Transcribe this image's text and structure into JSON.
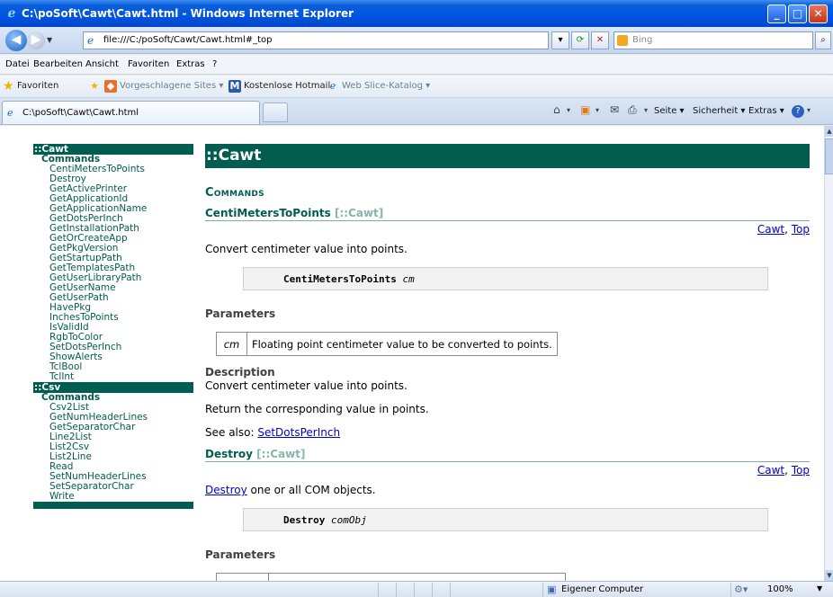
{
  "window": {
    "title": "C:\\poSoft\\Cawt\\Cawt.html - Windows Internet Explorer",
    "min_icon": "minimize-icon",
    "max_icon": "maximize-icon",
    "close_icon": "close-icon"
  },
  "address": {
    "url": "file:///C:/poSoft/Cawt/Cawt.html#_top",
    "search_placeholder": "Bing"
  },
  "menu": [
    "Datei",
    "Bearbeiten",
    "Ansicht",
    "Favoriten",
    "Extras",
    "?"
  ],
  "favorites": {
    "label": "Favoriten",
    "items": [
      "Vorgeschlagene Sites ▾",
      "Kostenlose Hotmail",
      "Web Slice-Katalog ▾"
    ]
  },
  "tab": {
    "label": "C:\\poSoft\\Cawt\\Cawt.html"
  },
  "commands": {
    "page": "Seite ▾",
    "security": "Sicherheit ▾",
    "extras": "Extras ▾"
  },
  "sidebar": {
    "sections": [
      {
        "ns": "::Cawt",
        "commands_label": "Commands",
        "items": [
          "CentiMetersToPoints",
          "Destroy",
          "GetActivePrinter",
          "GetApplicationId",
          "GetApplicationName",
          "GetDotsPerInch",
          "GetInstallationPath",
          "GetOrCreateApp",
          "GetPkgVersion",
          "GetStartupPath",
          "GetTemplatesPath",
          "GetUserLibraryPath",
          "GetUserName",
          "GetUserPath",
          "HavePkg",
          "InchesToPoints",
          "IsValidId",
          "RgbToColor",
          "SetDotsPerInch",
          "ShowAlerts",
          "TclBool",
          "TclInt"
        ]
      },
      {
        "ns": "::Csv",
        "commands_label": "Commands",
        "items": [
          "Csv2List",
          "GetNumHeaderLines",
          "GetSeparatorChar",
          "Line2List",
          "List2Csv",
          "List2Line",
          "Read",
          "SetNumHeaderLines",
          "SetSeparatorChar",
          "Write"
        ]
      }
    ]
  },
  "main": {
    "heading": "::Cawt",
    "commands_heading": "Commands",
    "procs": [
      {
        "name": "CentiMetersToPoints",
        "ns": "[::Cawt]",
        "link_cawt": "Cawt",
        "link_sep": ", ",
        "link_top": "Top",
        "summary": "Convert centimeter value into points.",
        "code_proc": "CentiMetersToPoints",
        "code_arg": "cm",
        "params_heading": "Parameters",
        "param_name": "cm",
        "param_desc": "Floating point centimeter value to be converted to points.",
        "desc_heading": "Description",
        "desc_line1": "Convert centimeter value into points.",
        "desc_line2": "Return the corresponding value in points.",
        "see_also_label": "See also: ",
        "see_also_link": "SetDotsPerInch"
      },
      {
        "name": "Destroy",
        "ns": "[::Cawt]",
        "link_cawt": "Cawt",
        "link_sep": ", ",
        "link_top": "Top",
        "summary_link": "Destroy",
        "summary_rest": " one or all COM objects.",
        "code_proc": "Destroy",
        "code_arg": "comObj",
        "params_heading": "Parameters"
      }
    ]
  },
  "status": {
    "zone": "Eigener Computer",
    "zoom": "100%"
  }
}
